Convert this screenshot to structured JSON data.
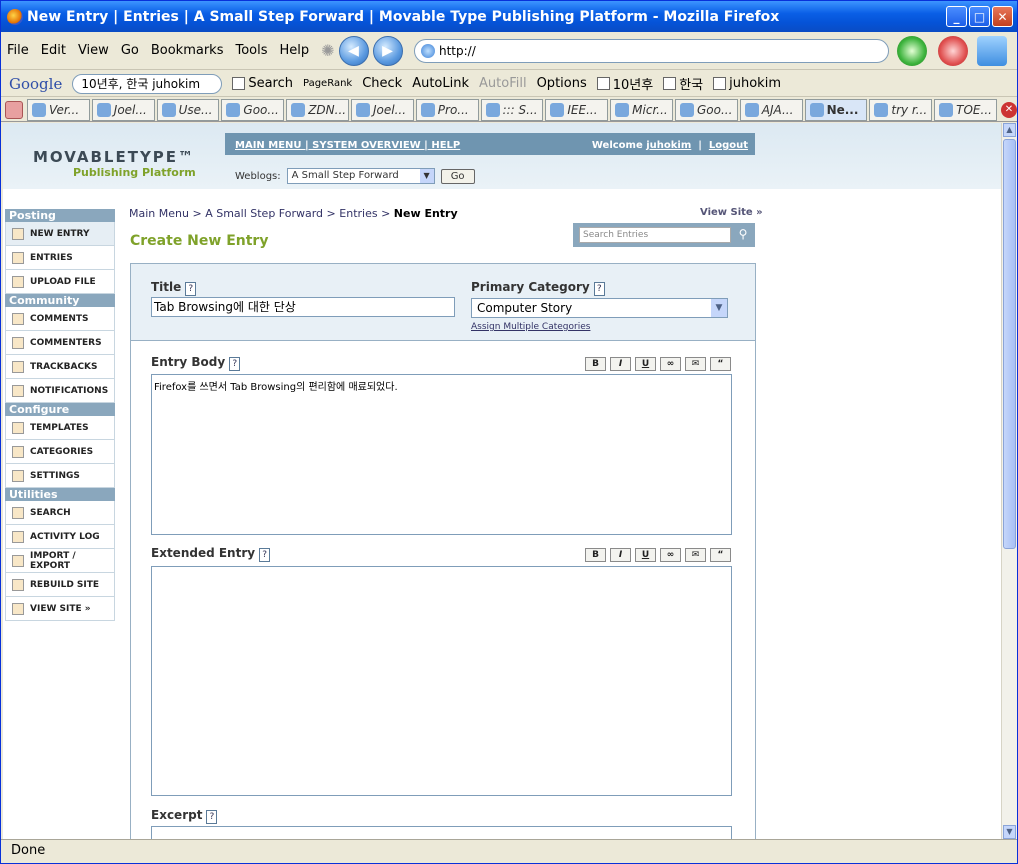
{
  "window": {
    "title": "New Entry | Entries | A Small Step Forward | Movable Type Publishing Platform - Mozilla Firefox"
  },
  "menu": [
    "File",
    "Edit",
    "View",
    "Go",
    "Bookmarks",
    "Tools",
    "Help"
  ],
  "address": {
    "url": "http://"
  },
  "googlebar": {
    "logo": "Google",
    "query": "10년후, 한국 juhokim",
    "search": "Search",
    "pagerank": "PageRank",
    "check": "Check",
    "autolink": "AutoLink",
    "autofill": "AutoFill",
    "options": "Options",
    "word1": "10년후",
    "word2": "한국",
    "word3": "juhokim"
  },
  "tabs": [
    "Ver...",
    "Joel...",
    "Use...",
    "Goo...",
    "ZDN...",
    "Joel...",
    "Pro...",
    "::: S...",
    "IEE...",
    "Micr...",
    "Goo...",
    "AJA...",
    "Ne...",
    "try r...",
    "TOE..."
  ],
  "active_tab": 12,
  "status": {
    "text": "Done"
  },
  "mt": {
    "logo_top": "MOVABLETYPE™",
    "logo_bottom": "Publishing Platform",
    "nav_links": "MAIN MENU | SYSTEM OVERVIEW | HELP",
    "welcome_prefix": "Welcome",
    "user": "juhokim",
    "logout": "Logout",
    "weblogs_label": "Weblogs:",
    "weblog_selected": "A Small Step Forward",
    "go": "Go"
  },
  "sidebar": {
    "sections": [
      {
        "title": "Posting",
        "items": [
          "NEW ENTRY",
          "ENTRIES",
          "UPLOAD FILE"
        ]
      },
      {
        "title": "Community",
        "items": [
          "COMMENTS",
          "COMMENTERS",
          "TRACKBACKS",
          "NOTIFICATIONS"
        ]
      },
      {
        "title": "Configure",
        "items": [
          "TEMPLATES",
          "CATEGORIES",
          "SETTINGS"
        ]
      },
      {
        "title": "Utilities",
        "items": [
          "SEARCH",
          "ACTIVITY LOG",
          "IMPORT / EXPORT",
          "REBUILD SITE",
          "VIEW SITE »"
        ]
      }
    ]
  },
  "breadcrumb": {
    "b1": "Main Menu",
    "b2": "A Small Step Forward",
    "b3": "Entries",
    "current": "New Entry"
  },
  "view_site": "View Site »",
  "page_title": "Create New Entry",
  "search_placeholder": "Search Entries",
  "form": {
    "title_label": "Title",
    "title_value": "Tab Browsing에 대한 단상",
    "category_label": "Primary Category",
    "category_value": "Computer Story",
    "assign_link": "Assign Multiple Categories",
    "body_label": "Entry Body",
    "body_value": "Firefox를 쓰면서 Tab Browsing의 편리함에 매료되었다.",
    "extended_label": "Extended Entry",
    "excerpt_label": "Excerpt",
    "toolbar": [
      "B",
      "I",
      "U",
      "∞",
      "✉",
      "“"
    ]
  }
}
